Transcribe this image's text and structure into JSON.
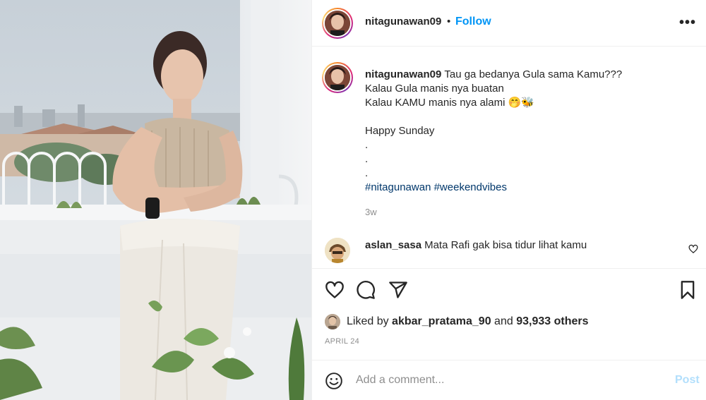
{
  "post": {
    "username": "nitagunawan09",
    "separator": "•",
    "follow_label": "Follow",
    "more_icon": "more-horizontal-icon",
    "caption": {
      "username": "nitagunawan09",
      "lines": [
        "Tau ga bedanya Gula sama Kamu???",
        "Kalau Gula manis nya buatan",
        "Kalau KAMU manis nya alami 🤭🐝",
        "",
        "Happy Sunday",
        ".",
        ".",
        "."
      ],
      "hashtags": "#nitagunawan #weekendvibes",
      "time_ago": "3w"
    },
    "comment": {
      "username": "aslan_sasa",
      "text": "Mata Rafi gak bisa tidur lihat kamu"
    },
    "likes": {
      "prefix": "Liked by",
      "user": "akbar_pratama_90",
      "middle": "and",
      "others": "93,933 others"
    },
    "date": "APRIL 24",
    "add_comment": {
      "placeholder": "Add a comment...",
      "post_label": "Post"
    }
  },
  "colors": {
    "accent": "#0095f6",
    "post_disabled": "#b2dffc",
    "hashtag": "#00376b",
    "muted": "#8e8e8e"
  }
}
